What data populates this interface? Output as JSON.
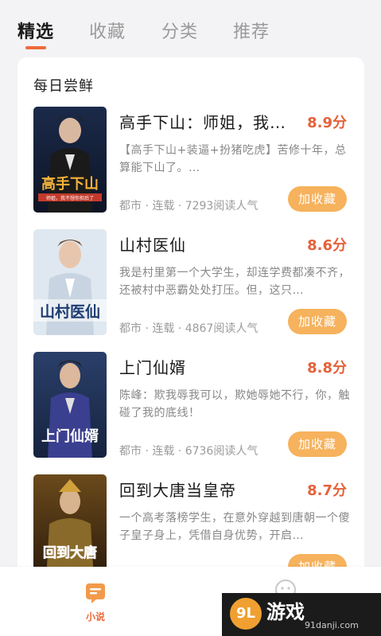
{
  "tabs": [
    {
      "label": "精选",
      "active": true
    },
    {
      "label": "收藏",
      "active": false
    },
    {
      "label": "分类",
      "active": false
    },
    {
      "label": "推荐",
      "active": false
    }
  ],
  "section": {
    "title": "每日尝鲜"
  },
  "books": [
    {
      "title": "高手下山：师姐，我…",
      "score": "8.9分",
      "desc": "【高手下山+装逼+扮猪吃虎】苦修十年，总算能下山了。…",
      "meta": "都市 · 连载 · 7293阅读人气",
      "button": "加收藏",
      "cover_text": "高手下山",
      "cover_sub": "师姐，我不想你担后了"
    },
    {
      "title": "山村医仙",
      "score": "8.6分",
      "desc": "我是村里第一个大学生，却连学费都凑不齐，还被村中恶霸处处打压。但，这只…",
      "meta": "都市 · 连载 · 4867阅读人气",
      "button": "加收藏",
      "cover_text": "山村医仙",
      "cover_sub": ""
    },
    {
      "title": "上门仙婿",
      "score": "8.8分",
      "desc": "陈峰：欺我辱我可以，欺她辱她不行，你，触碰了我的底线！",
      "meta": "都市 · 连载 · 6736阅读人气",
      "button": "加收藏",
      "cover_text": "上门仙婿",
      "cover_sub": ""
    },
    {
      "title": "回到大唐当皇帝",
      "score": "8.7分",
      "desc": "一个高考落榜学生，在意外穿越到唐朝一个傻子皇子身上，凭借自身优势，开启…",
      "meta": "",
      "button": "加收藏",
      "cover_text": "回到大唐",
      "cover_sub": ""
    }
  ],
  "bottom_nav": [
    {
      "label": "小说",
      "icon": "book-chat-icon",
      "active": true
    },
    {
      "label": "",
      "icon": "smiley-icon",
      "active": false
    }
  ],
  "watermark": {
    "logo": "9L",
    "name": "游戏",
    "url": "91danji.com"
  },
  "colors": {
    "accent": "#ee6a3b",
    "score": "#e4623a",
    "button": "#f6b25c"
  }
}
